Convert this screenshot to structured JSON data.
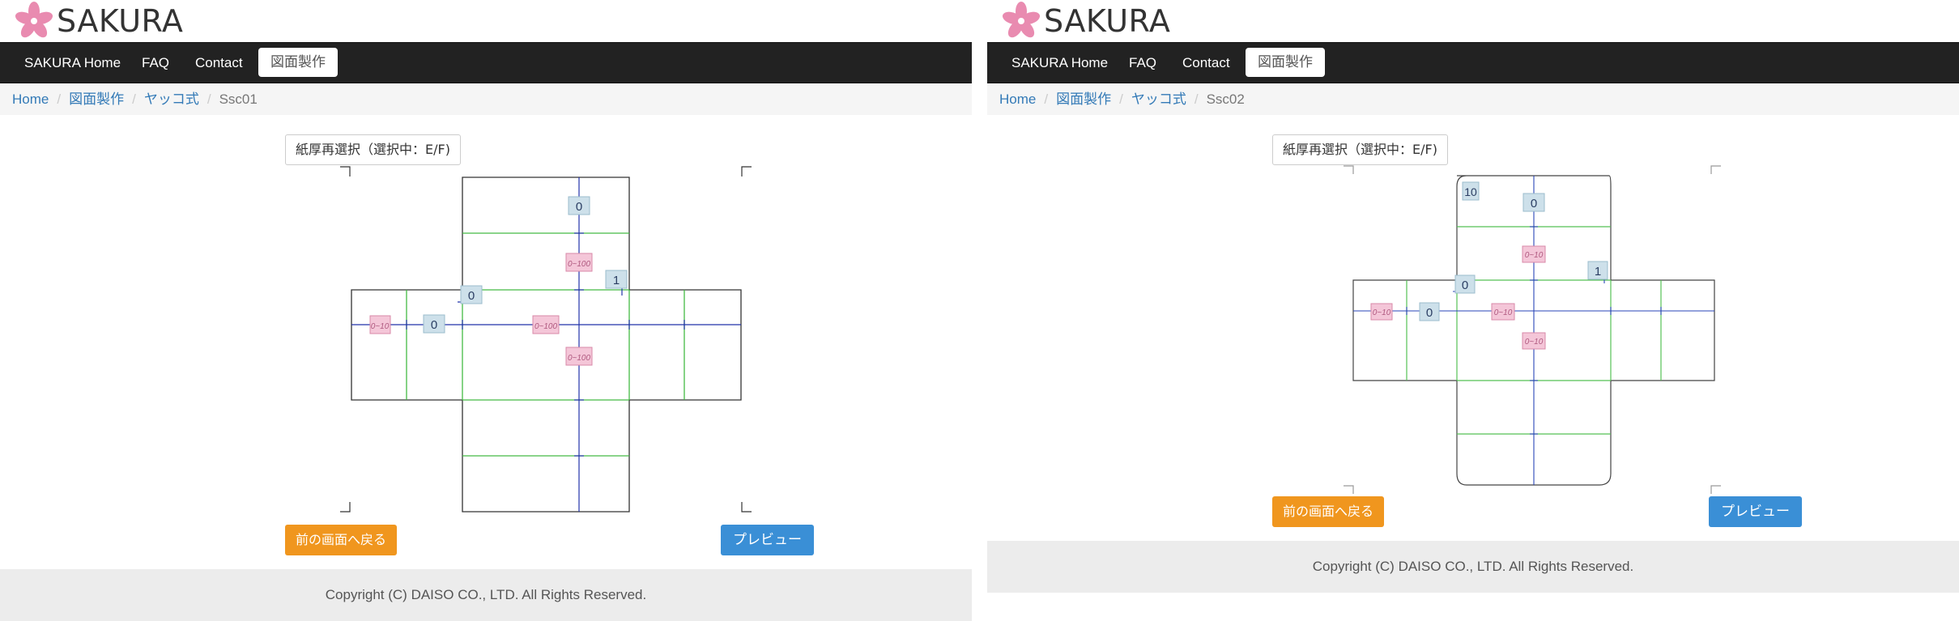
{
  "brand": {
    "name": "SAKURA"
  },
  "nav": {
    "items": [
      {
        "label": "SAKURA Home"
      },
      {
        "label": "FAQ"
      },
      {
        "label": "Contact"
      },
      {
        "label": "図面製作"
      }
    ]
  },
  "breadcrumb": {
    "home": "Home",
    "level1": "図面製作",
    "level2": "ヤッコ式",
    "current_a": "Ssc01",
    "current_b": "Ssc02",
    "separator": "/"
  },
  "controls": {
    "select_label": "紙厚再選択（選択中：E/F)",
    "back_label": "前の画面へ戻る",
    "preview_label": "プレビュー"
  },
  "diagram_a": {
    "value_boxes": [
      "0",
      "1",
      "0",
      "0"
    ],
    "range_boxes": [
      "0~100",
      "0~10",
      "0~100",
      "0~100"
    ]
  },
  "diagram_b": {
    "value_boxes": [
      "10",
      "0",
      "1",
      "0",
      "0"
    ],
    "range_boxes": [
      "0~10",
      "0~10",
      "0~10",
      "0~10"
    ]
  },
  "footer": {
    "copyright": "Copyright (C) DAISO CO., LTD. All Rights Reserved."
  },
  "colors": {
    "navbar": "#222222",
    "accent_link": "#337ab7",
    "back_button": "#f0961e",
    "preview_button": "#3a8fd6",
    "fold_line": "#44bb44",
    "dim_line": "#2233aa",
    "value_box": "#cde0ea",
    "range_box": "#f4c6d8"
  },
  "icons": {
    "logo": "sakura-flower-icon"
  }
}
